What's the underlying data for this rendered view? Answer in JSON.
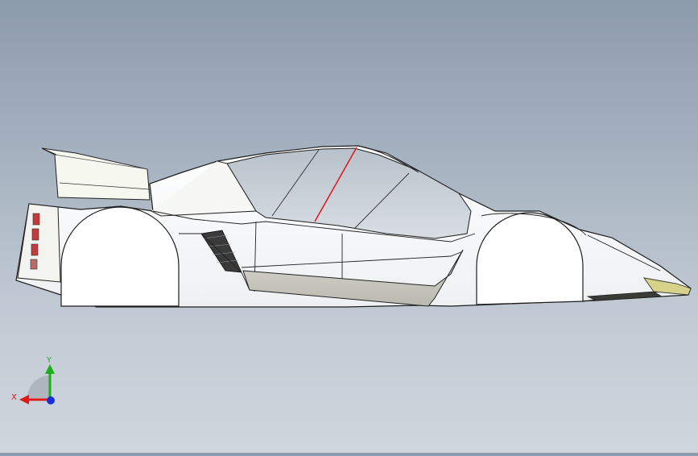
{
  "viewport": {
    "model": "car-body-side-view"
  },
  "triad": {
    "x_label": "X",
    "y_label": "Y",
    "colors": {
      "x": "#e01818",
      "y": "#19b019",
      "z": "#1a2fd8"
    }
  },
  "colors": {
    "background_top": "#8c9bac",
    "background_bottom": "#d0d6de",
    "body": "#ffffff",
    "edge": "#222222",
    "glass": "#c9d0d8",
    "accent_line": "#e02020",
    "nose_tip": "#d6d28a"
  }
}
